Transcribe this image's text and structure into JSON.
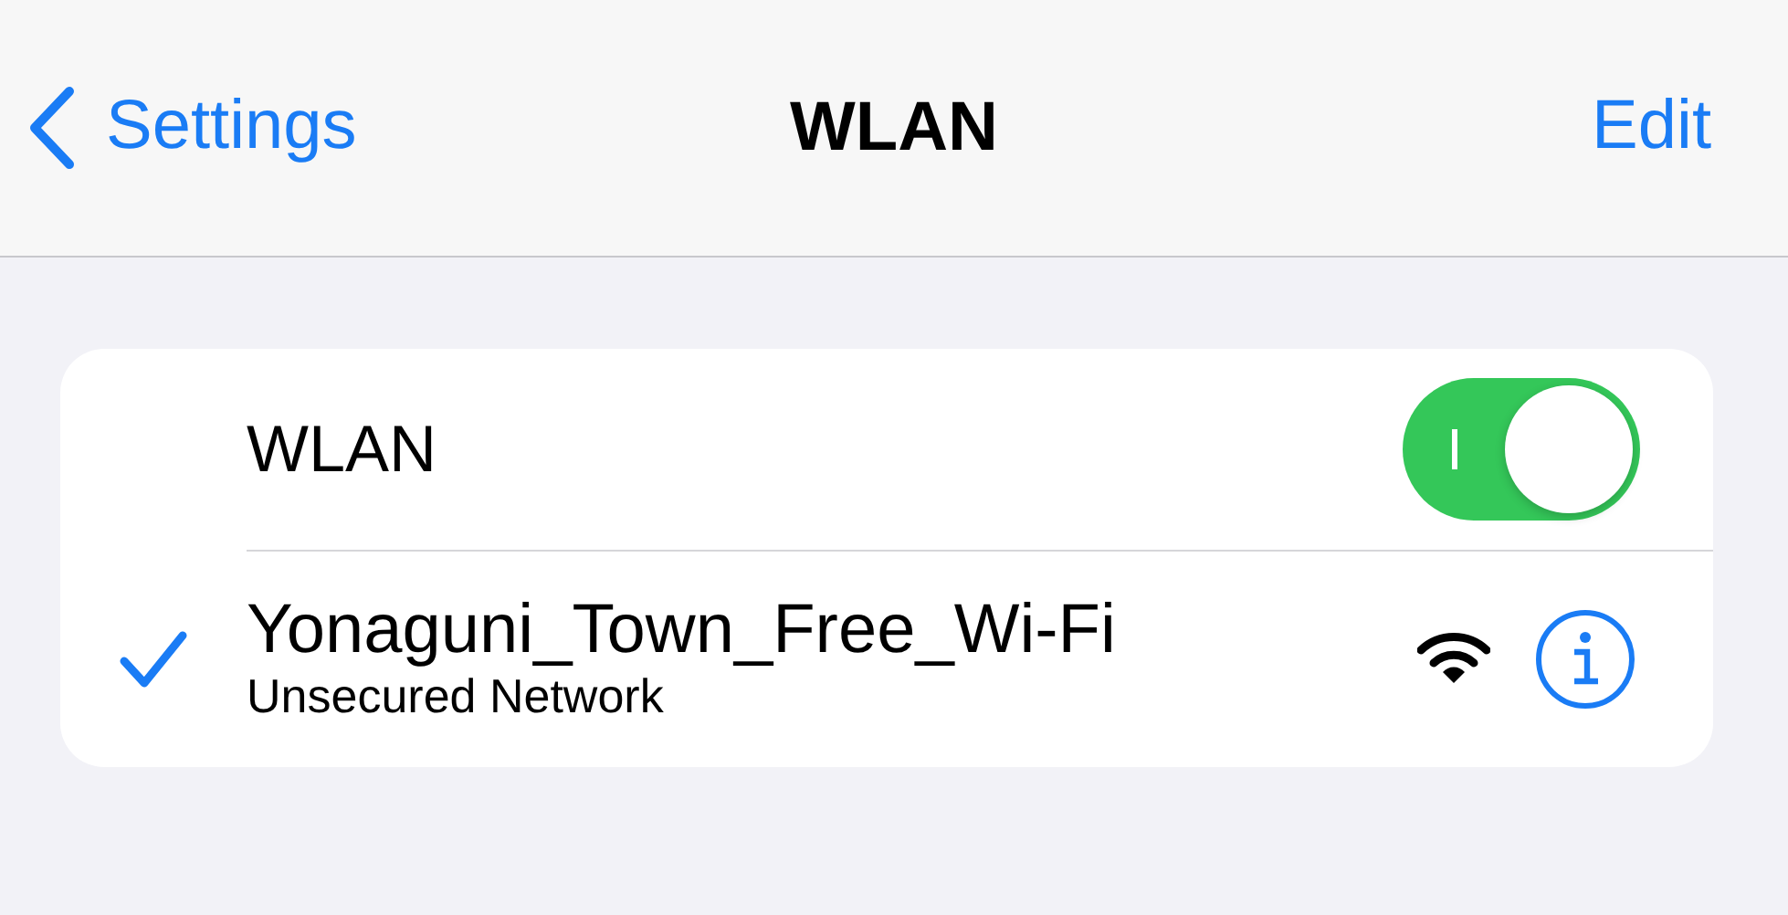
{
  "nav": {
    "back_label": "Settings",
    "title": "WLAN",
    "edit_label": "Edit"
  },
  "wlan_toggle": {
    "label": "WLAN",
    "on": true
  },
  "networks": [
    {
      "name": "Yonaguni_Town_Free_Wi-Fi",
      "subtitle": "Unsecured Network",
      "selected": true
    }
  ]
}
